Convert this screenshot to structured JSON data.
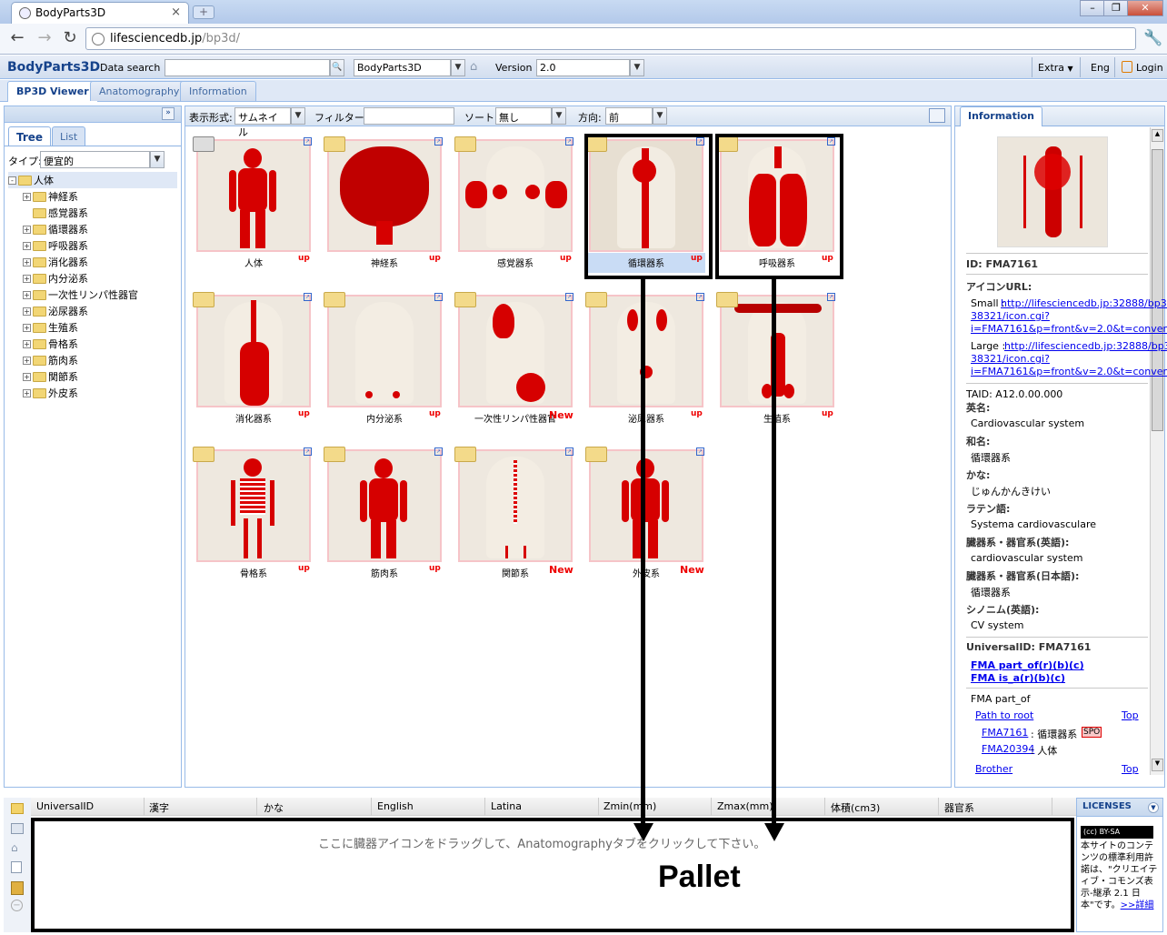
{
  "browser": {
    "tab_title": "BodyParts3D",
    "url_host": "lifesciencedb.jp",
    "url_path": "/bp3d/"
  },
  "header": {
    "brand": "BodyParts3D",
    "data_search_label": "Data search :",
    "dataset_value": "BodyParts3D",
    "version_label": "Version :",
    "version_value": "2.0",
    "extra": "Extra",
    "lang": "Eng",
    "login": "Login"
  },
  "main_tabs": [
    "BP3D Viewer",
    "Anatomography",
    "Information"
  ],
  "left": {
    "tabs": [
      "Tree",
      "List"
    ],
    "type_label": "タイプ:",
    "type_value": "便宜的",
    "tree": [
      {
        "label": "人体",
        "level": 0,
        "exp": "-"
      },
      {
        "label": "神経系",
        "level": 1,
        "exp": "+"
      },
      {
        "label": "感覚器系",
        "level": 1,
        "exp": ""
      },
      {
        "label": "循環器系",
        "level": 1,
        "exp": "+"
      },
      {
        "label": "呼吸器系",
        "level": 1,
        "exp": "+"
      },
      {
        "label": "消化器系",
        "level": 1,
        "exp": "+"
      },
      {
        "label": "内分泌系",
        "level": 1,
        "exp": "+"
      },
      {
        "label": "一次性リンパ性器官",
        "level": 1,
        "exp": "+"
      },
      {
        "label": "泌尿器系",
        "level": 1,
        "exp": "+"
      },
      {
        "label": "生殖系",
        "level": 1,
        "exp": "+"
      },
      {
        "label": "骨格系",
        "level": 1,
        "exp": "+"
      },
      {
        "label": "筋肉系",
        "level": 1,
        "exp": "+"
      },
      {
        "label": "関節系",
        "level": 1,
        "exp": "+"
      },
      {
        "label": "外皮系",
        "level": 1,
        "exp": "+"
      }
    ]
  },
  "center_toolbar": {
    "display_label": "表示形式:",
    "display_value": "サムネイル",
    "filter_label": "フィルター:",
    "sort_label": "ソート:",
    "sort_value": "無し",
    "direction_label": "方向:",
    "direction_value": "前"
  },
  "thumbnails": [
    {
      "label": "人体",
      "badge": "up"
    },
    {
      "label": "神経系",
      "badge": "up"
    },
    {
      "label": "感覚器系",
      "badge": "up"
    },
    {
      "label": "循環器系",
      "badge": "up"
    },
    {
      "label": "呼吸器系",
      "badge": "up"
    },
    {
      "label": "消化器系",
      "badge": "up"
    },
    {
      "label": "内分泌系",
      "badge": "up"
    },
    {
      "label": "一次性リンパ性器官",
      "badge": "New"
    },
    {
      "label": "泌尿器系",
      "badge": "up"
    },
    {
      "label": "生殖系",
      "badge": "up"
    },
    {
      "label": "骨格系",
      "badge": "up"
    },
    {
      "label": "筋肉系",
      "badge": "up"
    },
    {
      "label": "関節系",
      "badge": "New"
    },
    {
      "label": "外皮系",
      "badge": "New"
    }
  ],
  "info": {
    "tab": "Information",
    "id": "ID: FMA7161",
    "icon_url_label": "アイコンURL:",
    "small_prefix": "Small : ",
    "small_url": [
      "http://lifesciencedb.jp:32888/bp3d-",
      "38321/icon.cgi?",
      "i=FMA7161&p=front&v=2.0&t=conventio"
    ],
    "large_prefix": "Large : ",
    "large_url": [
      "http://lifesciencedb.jp:32888/bp3d-",
      "38321/icon.cgi?",
      "i=FMA7161&p=front&v=2.0&t=conventio"
    ],
    "taid": "TAID:  A12.0.00.000",
    "en_label": "英名:",
    "en_value": "Cardiovascular system",
    "ja_label": "和名:",
    "ja_value": "循環器系",
    "kana_label": "かな:",
    "kana_value": "じゅんかんきけい",
    "latin_label": "ラテン語:",
    "latin_value": "Systema cardiovasculare",
    "sys_en_label": "臓器系・器官系(英語):",
    "sys_en_value": "cardiovascular system",
    "sys_ja_label": "臓器系・器官系(日本語):",
    "sys_ja_value": "循環器系",
    "syn_label": "シノニム(英語):",
    "syn_value": "CV system",
    "uid": "UniversalID:  FMA7161",
    "fma_part_of_link": "FMA part_of(r)(b)(c)",
    "fma_is_a_link": "FMA is_a(r)(b)(c)",
    "fma_part_of": "FMA part_of",
    "path_to_root": "Path to root",
    "top": "Top",
    "path1_id": "FMA7161",
    "path1_name": ": 循環器系 :",
    "spo": "SPO",
    "path2_id": "FMA20394",
    "path2_name": ": 人体",
    "brother": "Brother"
  },
  "grid_columns": [
    "UniversalID",
    "漢字",
    "かな",
    "English",
    "Latina",
    "Zmin(mm)",
    "Zmax(mm)",
    "体積(cm3)",
    "器官系"
  ],
  "pallet": {
    "hint": "ここに臓器アイコンをドラッグして、Anatomographyタブをクリックして下さい。",
    "annotation": "Pallet"
  },
  "licenses": {
    "title": "LICENSES",
    "cc": "(cc) BY-SA",
    "text": "本サイトのコンテンツの標準利用許諾は、\"クリエイティブ・コモンズ表示-継承 2.1 日本\"です。",
    "more": ">>詳細"
  }
}
